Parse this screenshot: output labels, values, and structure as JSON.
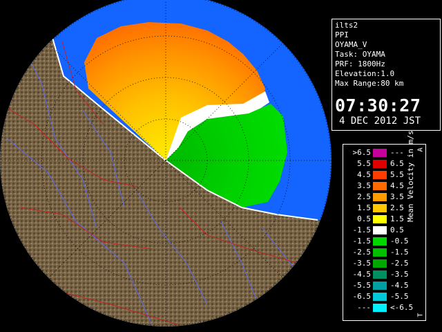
{
  "info": {
    "lines": [
      "ilts2",
      "PPI",
      "OYAMA_V",
      "Task: OYAMA",
      "PRF: 1800Hz",
      "Elevation:1.0",
      "Max Range:80 km"
    ],
    "time": "07:30:27",
    "date": "4 DEC 2012 JST"
  },
  "legend": {
    "title": "Mean Velocity in m/s",
    "top_marker": "A",
    "bottom_marker": "T",
    "rows": [
      {
        "lo": ">6.5",
        "hi": "---",
        "color": "#c8009c"
      },
      {
        "lo": "5.5",
        "hi": "6.5",
        "color": "#e00000"
      },
      {
        "lo": "4.5",
        "hi": "5.5",
        "color": "#ff3c00"
      },
      {
        "lo": "3.5",
        "hi": "4.5",
        "color": "#ff6a00"
      },
      {
        "lo": "2.5",
        "hi": "3.5",
        "color": "#ff9a00"
      },
      {
        "lo": "1.5",
        "hi": "2.5",
        "color": "#ffc800"
      },
      {
        "lo": "0.5",
        "hi": "1.5",
        "color": "#ffff00"
      },
      {
        "lo": "-1.5",
        "hi": "0.5",
        "color": "#ffffff"
      },
      {
        "lo": "-1.5",
        "hi": "-0.5",
        "color": "#00d800"
      },
      {
        "lo": "-2.5",
        "hi": "-1.5",
        "color": "#00c000"
      },
      {
        "lo": "-3.5",
        "hi": "-2.5",
        "color": "#00a800"
      },
      {
        "lo": "-4.5",
        "hi": "-3.5",
        "color": "#009060"
      },
      {
        "lo": "-5.5",
        "hi": "-4.5",
        "color": "#00a0a0"
      },
      {
        "lo": "-6.5",
        "hi": "-5.5",
        "color": "#00c8d8"
      },
      {
        "lo": "---",
        "hi": "<-6.5",
        "color": "#00f0ff"
      }
    ]
  },
  "map_colors": {
    "background": "#000000",
    "range_disk": "#1464ff",
    "terrain": "#7a6646",
    "terrain_dark": "#4a3a26",
    "rivers": "#5a6aff",
    "boundaries": "#c81e1e"
  }
}
